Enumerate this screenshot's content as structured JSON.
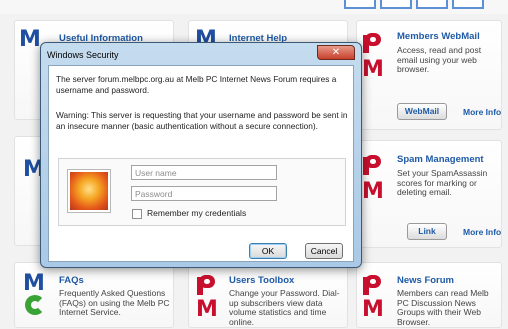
{
  "window": {
    "title": "Windows Security",
    "close_glyph": "✕"
  },
  "dialog": {
    "message": "The server forum.melbpc.org.au at Melb PC Internet News Forum requires a username and password.",
    "warning": "Warning: This server is requesting that your username and password be sent in an insecure manner (basic authentication without a secure connection).",
    "username": {
      "placeholder": "User name",
      "value": ""
    },
    "password": {
      "placeholder": "Password",
      "value": ""
    },
    "remember_label": "Remember my credentials",
    "remember_checked": false,
    "ok_label": "OK",
    "cancel_label": "Cancel"
  },
  "tiles": {
    "useful_info": {
      "title": "Useful Information"
    },
    "internet_help": {
      "title": "Internet Help"
    },
    "webmail": {
      "title": "Members WebMail",
      "text": "Access, read and post email using your web browser.",
      "button": "WebMail",
      "more": "More Info"
    },
    "spam": {
      "title": "Spam Management",
      "text": "Set your SpamAssassin scores for marking or deleting email.",
      "button": "Link",
      "more": "More Info"
    },
    "faqs": {
      "title": "FAQs",
      "text": "Frequently Asked Questions (FAQs) on using the Melb PC Internet Service."
    },
    "users_toolbox": {
      "title": "Users Toolbox",
      "text": "Change your Password. Dial-up subscribers view data volume statistics and time online."
    },
    "news_forum": {
      "title": "News Forum",
      "text": "Members can read Melb PC Discussion News Groups with their Web Browser."
    }
  },
  "icons": {
    "m_logo": "M",
    "colors": {
      "m_blue": "#1f4fa0",
      "m_green": "#3aa335",
      "p_red": "#c8102e",
      "link_blue": "#1f5aa6"
    }
  }
}
